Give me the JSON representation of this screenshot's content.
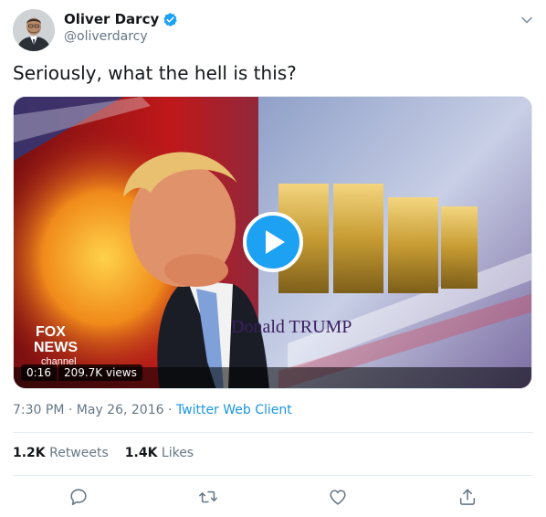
{
  "author": {
    "display_name": "Oliver Darcy",
    "handle": "@oliverdarcy",
    "verified": true
  },
  "tweet": {
    "text": "Seriously, what the hell is this?"
  },
  "video": {
    "duration": "0:16",
    "views": "209.7K views",
    "caption_name": "Donald TRUMP",
    "logo_line1": "FOX",
    "logo_line2": "NEWS",
    "logo_line3": "channel"
  },
  "meta": {
    "time": "7:30 PM",
    "separator": " · ",
    "date": "May 26, 2016",
    "client": "Twitter Web Client"
  },
  "stats": {
    "retweets_count": "1.2K",
    "retweets_label": "Retweets",
    "likes_count": "1.4K",
    "likes_label": "Likes"
  },
  "colors": {
    "accent": "#1da1f2",
    "link": "#1b95e0",
    "muted": "#657786",
    "text": "#14171a"
  },
  "icons": [
    "verified-icon",
    "chevron-down-icon",
    "play-icon",
    "reply-icon",
    "retweet-icon",
    "like-icon",
    "share-icon"
  ]
}
